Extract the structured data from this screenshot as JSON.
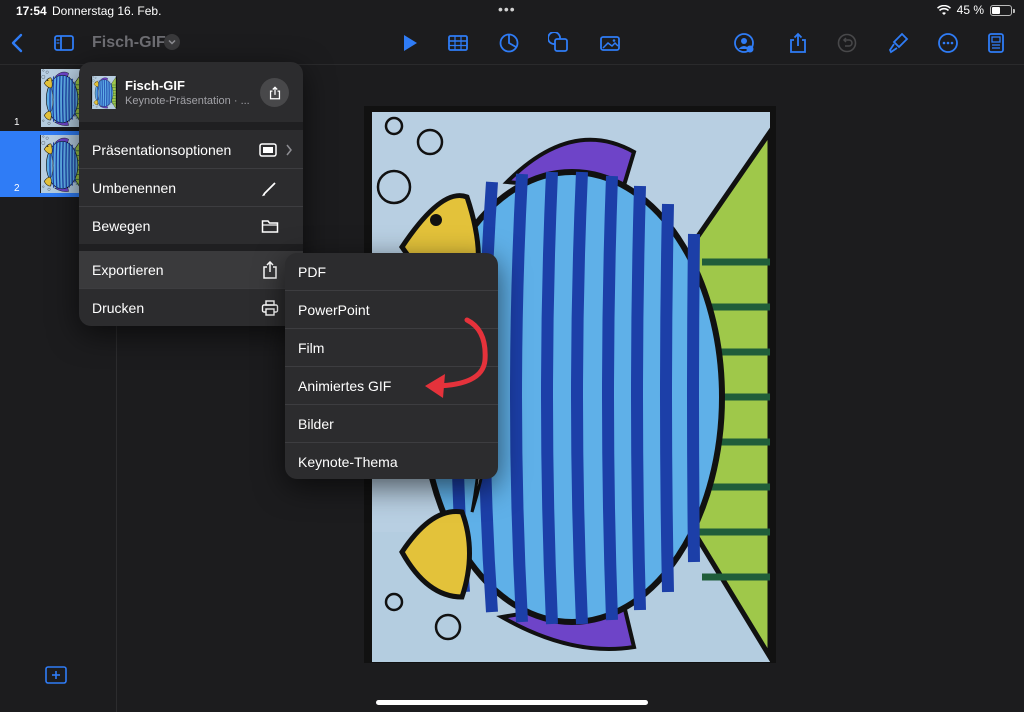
{
  "status": {
    "time": "17:54",
    "date": "Donnerstag 16. Feb.",
    "battery": "45 %",
    "battery_level": 0.45
  },
  "toolbar": {
    "document_title": "Fisch-GIF",
    "icons": [
      "back-chevron-icon",
      "sidebar-icon",
      "chevron-down-icon",
      "play-icon",
      "table-icon",
      "chart-icon",
      "shape-icon",
      "media-icon",
      "collaborate-icon",
      "share-icon",
      "undo-icon",
      "format-brush-icon",
      "more-icon",
      "presenter-notes-icon"
    ]
  },
  "navigator": {
    "slides": [
      {
        "number": "1",
        "selected": false
      },
      {
        "number": "2",
        "selected": true
      }
    ]
  },
  "document_menu": {
    "name": "Fisch-GIF",
    "subtitle": "Keynote-Präsentation · ...",
    "items": [
      {
        "label": "Präsentationsoptionen",
        "icon": "presentation-options-icon",
        "has_submenu": true
      },
      {
        "label": "Umbenennen",
        "icon": "pencil-icon"
      },
      {
        "label": "Bewegen",
        "icon": "folder-icon"
      },
      {
        "label": "Exportieren",
        "icon": "export-icon",
        "highlighted": true
      },
      {
        "label": "Drucken",
        "icon": "printer-icon"
      }
    ]
  },
  "export_submenu": {
    "items": [
      {
        "label": "PDF"
      },
      {
        "label": "PowerPoint"
      },
      {
        "label": "Film"
      },
      {
        "label": "Animiertes GIF",
        "annotated": true
      },
      {
        "label": "Bilder"
      },
      {
        "label": "Keynote-Thema"
      }
    ]
  },
  "colors": {
    "accent": "#2f7cf6",
    "annotation_arrow": "#e5323b",
    "menu_background": "#2c2c2e",
    "app_background": "#1c1c1e"
  }
}
